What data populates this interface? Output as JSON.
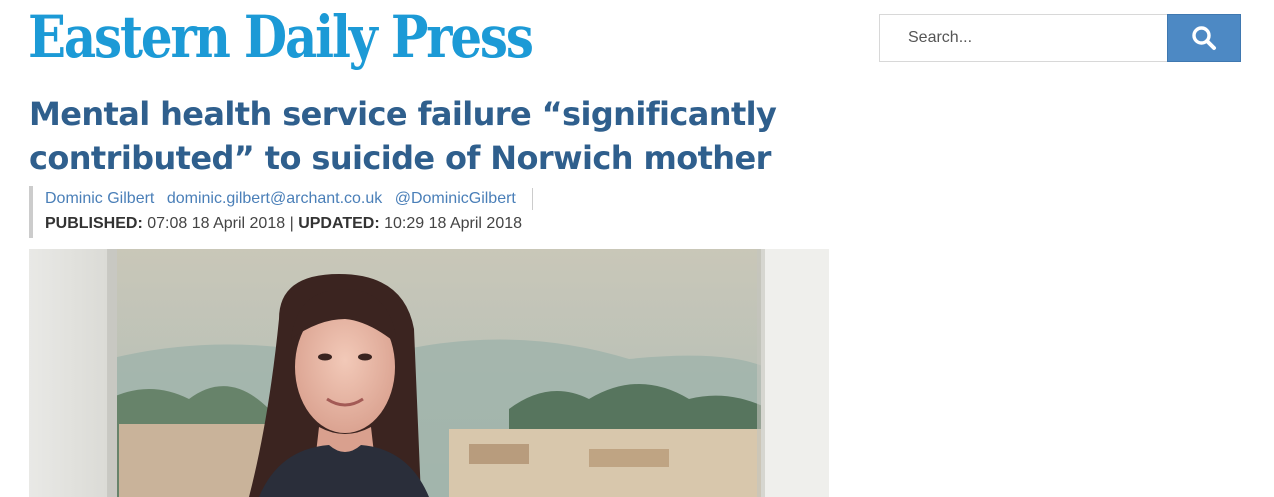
{
  "header": {
    "logo_text": "Eastern Daily Press",
    "brand_color": "#1c9ad6"
  },
  "search": {
    "placeholder": "Search...",
    "button_icon": "search-icon",
    "button_color": "#4d89c4"
  },
  "article": {
    "headline": "Mental health service failure “significantly contributed” to suicide of Norwich mother",
    "author_name": "Dominic Gilbert",
    "author_email": "dominic.gilbert@archant.co.uk",
    "author_twitter": "@DominicGilbert",
    "published_label": "PUBLISHED:",
    "published_value": "07:08 18 April 2018",
    "divider": "|",
    "updated_label": "UPDATED:",
    "updated_value": "10:29 18 April 2018",
    "headline_color": "#2f5f8d"
  }
}
